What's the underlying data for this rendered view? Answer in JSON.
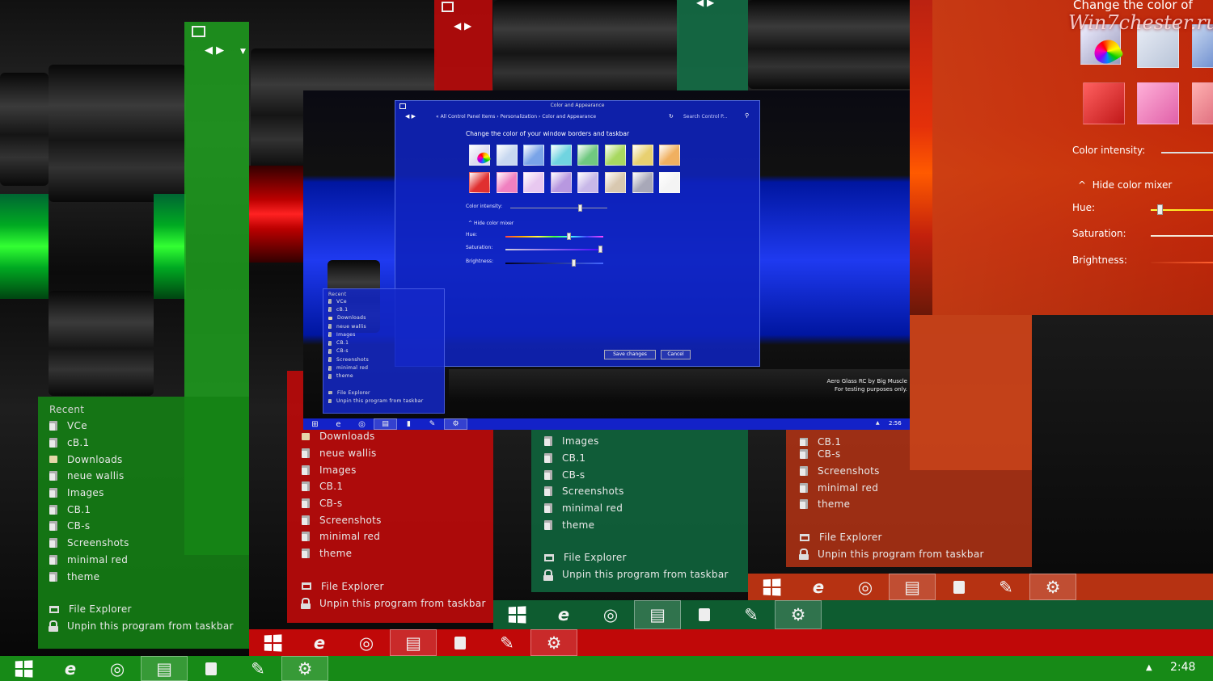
{
  "jump_list": {
    "header": "Recent",
    "items": [
      "VCe",
      "cB.1",
      "Downloads",
      "neue wallis",
      "Images",
      "CB.1",
      "CB-s",
      "Screenshots",
      "minimal red",
      "theme"
    ],
    "file_explorer": "File Explorer",
    "unpin": "Unpin this program from taskbar"
  },
  "red_list": {
    "items": [
      "Downloads",
      "neue wallis",
      "Images",
      "CB.1",
      "CB-s",
      "Screenshots",
      "minimal red",
      "theme"
    ]
  },
  "teal_list": {
    "items": [
      "Images",
      "CB.1",
      "CB-s",
      "Screenshots",
      "minimal red",
      "theme"
    ]
  },
  "orange_list": {
    "items": [
      "CB.1",
      "CB-s",
      "Screenshots",
      "minimal red",
      "theme"
    ]
  },
  "control_panel": {
    "window_title": "Color and Appearance",
    "breadcrumb": "« All Control Panel Items  ›  Personalization  ›  Color and Appearance",
    "search_placeholder": "Search Control P...",
    "heading": "Change the color of your window borders and taskbar",
    "color_intensity_label": "Color intensity:",
    "hide_mixer_label": "Hide color mixer",
    "hue_label": "Hue:",
    "saturation_label": "Saturation:",
    "brightness_label": "Brightness:",
    "save_label": "Save changes",
    "cancel_label": "Cancel",
    "watermark_line1": "Aero Glass RC by Big Muscle",
    "watermark_line2": "For testing purposes only.",
    "clock": "2:56",
    "color_intensity": 0.7,
    "hue": 0.63,
    "saturation": 0.95,
    "brightness": 0.68,
    "swatches": [
      "#dcdcf0",
      "#c8d8f0",
      "#7aa4e8",
      "#70d4e0",
      "#70c880",
      "#a8d860",
      "#e8d070",
      "#f0b060",
      "#e03030",
      "#f080c0",
      "#e8c8f0",
      "#b898e0",
      "#c8b8e8",
      "#d8c8b0",
      "#a8a8b8",
      "#f4f4f4"
    ]
  },
  "orange_panel": {
    "heading": "Change the color of",
    "color_intensity_label": "Color intensity:",
    "hide_mixer_label": "Hide color mixer",
    "hue_label": "Hue:",
    "saturation_label": "Saturation:",
    "brightness_label": "Brightness:",
    "hue": 0.05,
    "swatches": [
      "#d02828",
      "#f080b8",
      "#e0e4f0",
      "#c0d4f0",
      "#e8a0c8",
      "#f09090"
    ]
  },
  "watermark_logo": "Win7chester.ru",
  "taskbar": {
    "clock": "2:48",
    "tray_arrow": "▲"
  },
  "colors": {
    "green": "#1d8a1d",
    "red": "#c00000",
    "teal": "#0f6a3a",
    "orange": "#d0421a",
    "blue": "#1227b8"
  }
}
